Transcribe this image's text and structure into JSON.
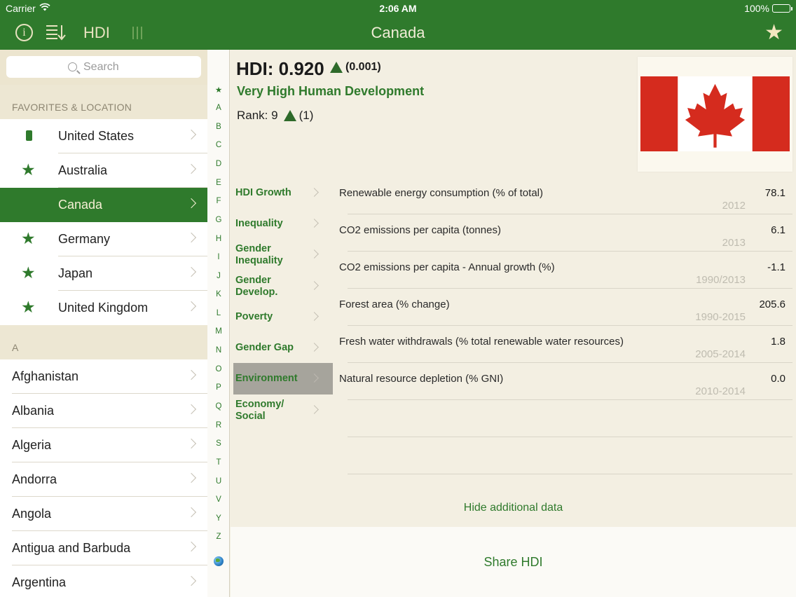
{
  "status_bar": {
    "carrier": "Carrier",
    "time": "2:06 AM",
    "battery": "100%"
  },
  "nav": {
    "hdi_tab": "HDI",
    "title": "Canada",
    "info_icon": "i"
  },
  "search": {
    "placeholder": "Search"
  },
  "sidebar": {
    "favorites_header": "FAVORITES & LOCATION",
    "favorites": [
      {
        "label": "United States",
        "icon": "phone-location-icon"
      },
      {
        "label": "Australia",
        "icon": "star-icon"
      },
      {
        "label": "Canada",
        "icon": "",
        "selected": true
      },
      {
        "label": "Germany",
        "icon": "star-icon"
      },
      {
        "label": "Japan",
        "icon": "star-icon"
      },
      {
        "label": "United Kingdom",
        "icon": "star-icon"
      }
    ],
    "section_a_header": "A",
    "countries_a": [
      "Afghanistan",
      "Albania",
      "Algeria",
      "Andorra",
      "Angola",
      "Antigua and Barbuda",
      "Argentina"
    ]
  },
  "index_bar": [
    "★",
    "A",
    "B",
    "C",
    "D",
    "E",
    "F",
    "G",
    "H",
    "I",
    "J",
    "K",
    "L",
    "M",
    "N",
    "O",
    "P",
    "Q",
    "R",
    "S",
    "T",
    "U",
    "V",
    "Y",
    "Z"
  ],
  "detail": {
    "hdi_label": "HDI: 0.920",
    "hdi_change": "(0.001)",
    "development_level": "Very High Human Development",
    "rank_label": "Rank: 9",
    "rank_change": "(1)",
    "flag_colors": {
      "red": "#d52b1e",
      "white": "#ffffff"
    },
    "subnav": [
      {
        "label": "HDI Growth"
      },
      {
        "label": "Inequality"
      },
      {
        "label": "Gender Inequality"
      },
      {
        "label": "Gender Develop."
      },
      {
        "label": "Poverty"
      },
      {
        "label": "Gender Gap"
      },
      {
        "label": "Environment",
        "active": true
      },
      {
        "label": "Economy/ Social"
      }
    ],
    "metrics": [
      {
        "label": "Renewable energy consumption (% of total)",
        "value": "78.1",
        "year": "2012"
      },
      {
        "label": "CO2 emissions per capita (tonnes)",
        "value": "6.1",
        "year": "2013"
      },
      {
        "label": "CO2 emissions per capita - Annual growth (%)",
        "value": "-1.1",
        "year": "1990/2013"
      },
      {
        "label": "Forest area (% change)",
        "value": "205.6",
        "year": "1990-2015"
      },
      {
        "label": "Fresh water withdrawals (% total renewable water resources)",
        "value": "1.8",
        "year": "2005-2014"
      },
      {
        "label": "Natural resource depletion (% GNI)",
        "value": "0.0",
        "year": "2010-2014"
      }
    ],
    "hide_data_label": "Hide additional data"
  },
  "share_label": "Share HDI",
  "colors": {
    "accent": "#2f7a2c",
    "background": "#f3efe2"
  }
}
